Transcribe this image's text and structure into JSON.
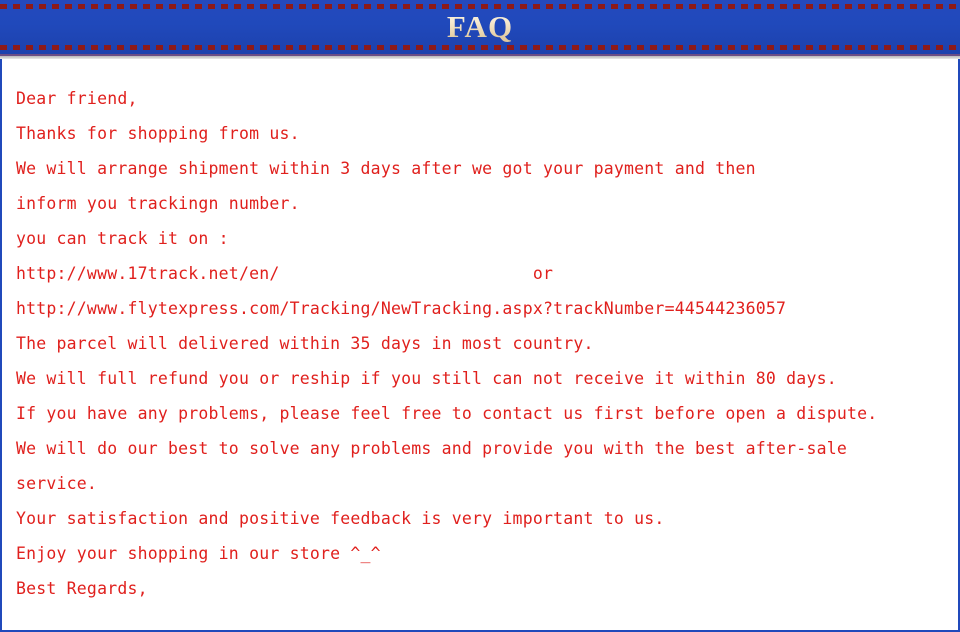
{
  "header": {
    "title": "FAQ",
    "title_color": "#f5e9cd",
    "banner_color": "#2049bb",
    "dash_color": "#8e1a18"
  },
  "body": {
    "text_color": "#e0201d",
    "background_color": "#ffffff",
    "border_color": "#2049bb",
    "lines": [
      "Dear friend,",
      "Thanks for shopping from us.",
      "We will arrange shipment within 3 days after we got your payment and then",
      "inform you trackingn number.",
      "you can track it on :",
      "http://www.17track.net/en/                         or",
      "http://www.flytexpress.com/Tracking/NewTracking.aspx?trackNumber=44544236057",
      "The parcel will delivered within 35 days in most country.",
      "We will full refund you or reship if you still can not receive it within 80 days.",
      "If you have any problems, please feel free to contact us first before open a dispute.",
      "We will do our best to solve any problems and provide you with the best after-sale",
      "service.",
      "Your satisfaction and positive feedback is very important to us.",
      "Enjoy your shopping in our store ^_^",
      "Best Regards,"
    ],
    "tracking_urls": [
      "http://www.17track.net/en/",
      "http://www.flytexpress.com/Tracking/NewTracking.aspx?trackNumber=44544236057"
    ],
    "tracking_number": "44544236057",
    "shipment_days": "3",
    "delivery_days": "35",
    "refund_days": "80"
  }
}
